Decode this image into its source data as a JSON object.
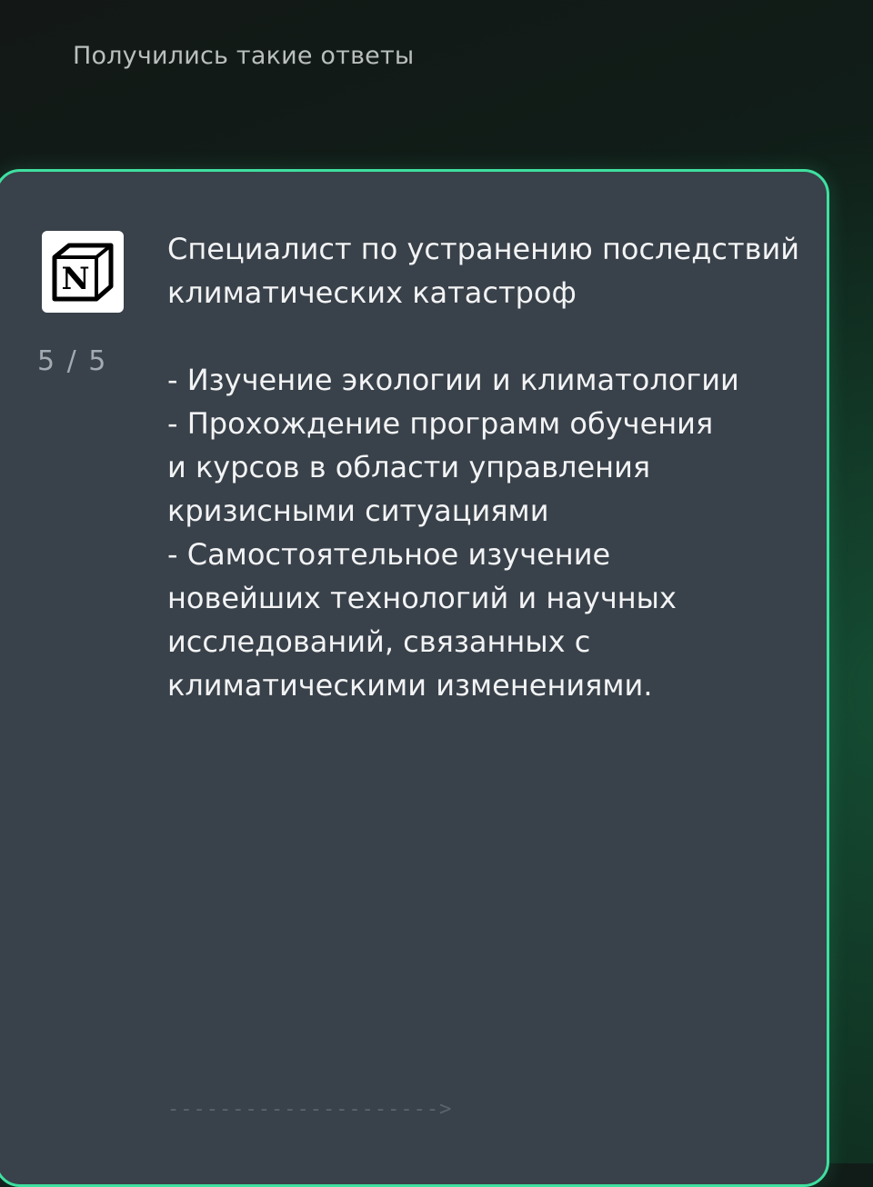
{
  "header": {
    "title": "Получились такие ответы"
  },
  "logo": {
    "icon": "notion-icon",
    "letter": "N"
  },
  "counter": {
    "current": "5",
    "separator": "/",
    "total": "5"
  },
  "content": {
    "title": "Специалист по устранению последствий климатических катастроф",
    "lines": [
      "- Изучение экологии и климатологии",
      "- Прохождение программ обучения",
      "и курсов в области управления",
      "кризисными ситуациями",
      "- Самостоятельное изучение",
      "новейших технологий и научных",
      "исследований, связанных с",
      "климатическими изменениями."
    ]
  },
  "footer": {
    "arrow": "--------------------->"
  },
  "colors": {
    "accent": "#3fe0a0",
    "card": "#39414a",
    "text": "#f2f3f4",
    "muted": "#a4aab1"
  }
}
